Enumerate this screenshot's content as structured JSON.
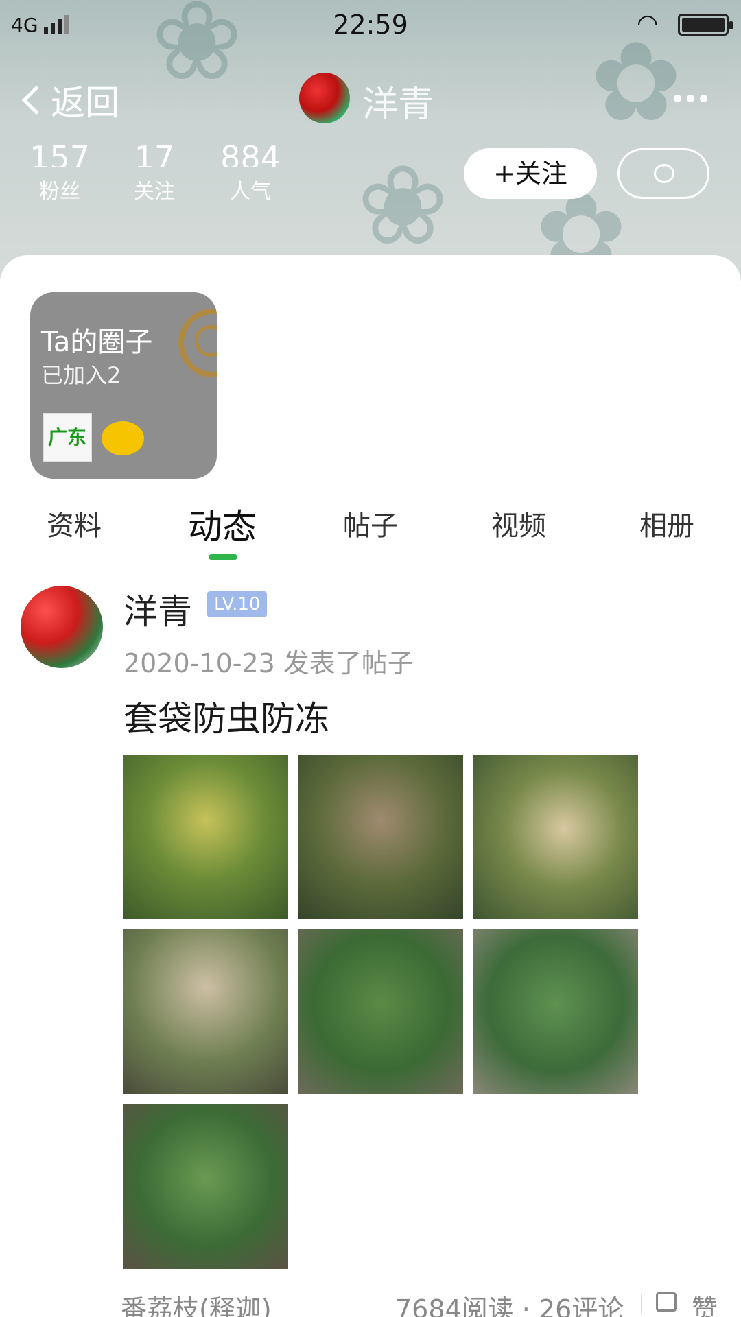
{
  "status_bar": {
    "network": "4G",
    "time": "22:59"
  },
  "nav": {
    "back_label": "返回",
    "title": "洋青"
  },
  "stats": [
    {
      "value": "157",
      "label": "粉丝"
    },
    {
      "value": "17",
      "label": "关注"
    },
    {
      "value": "884",
      "label": "人气"
    }
  ],
  "actions": {
    "follow_label": "+关注"
  },
  "circles": {
    "title": "Ta的圈子",
    "joined": "已加入2",
    "badge_text": "广东"
  },
  "tabs": [
    {
      "label": "资料",
      "active": false
    },
    {
      "label": "动态",
      "active": true
    },
    {
      "label": "帖子",
      "active": false
    },
    {
      "label": "视频",
      "active": false
    },
    {
      "label": "相册",
      "active": false
    }
  ],
  "post": {
    "author": "洋青",
    "level": "LV.10",
    "meta": "2020-10-23 发表了帖子",
    "title": "套袋防虫防冻",
    "image_count": 7,
    "category": "番荔枝(释迦)",
    "stats": "7684阅读 · 26评论",
    "like_label": "赞"
  },
  "colors": {
    "accent": "#2fb54a",
    "level_badge": "#9fb9ea",
    "card_gray": "#8e8e8e"
  }
}
